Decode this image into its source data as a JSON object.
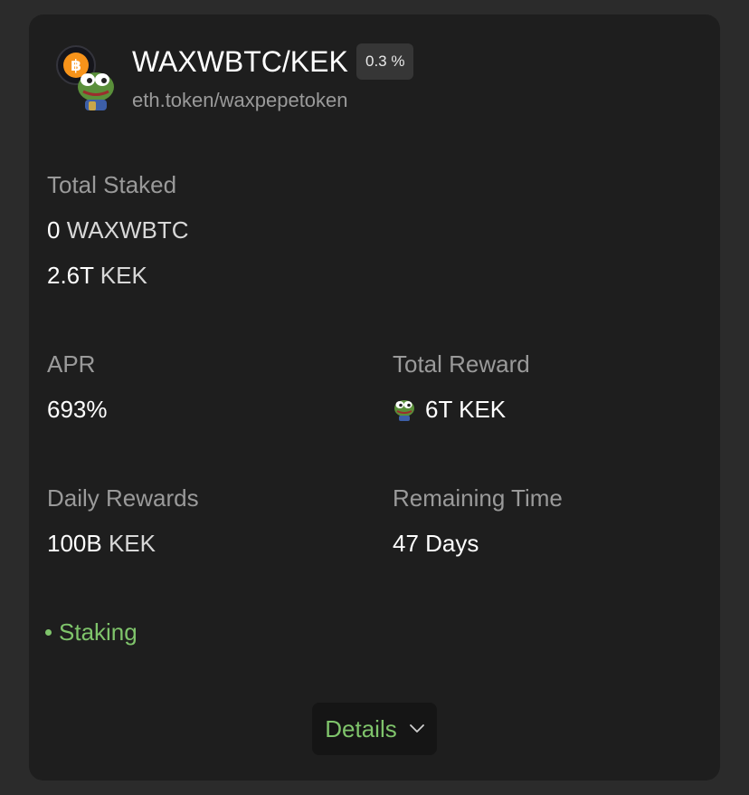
{
  "pool": {
    "pair_name": "WAXWBTC/KEK",
    "fee": "0.3 %",
    "contract": "eth.token/waxpepetoken",
    "icons": [
      "bitcoin-icon",
      "pepe-frog-icon"
    ]
  },
  "total_staked": {
    "label": "Total Staked",
    "token_a_amount": "0",
    "token_a_symbol": "WAXWBTC",
    "token_b_amount": "2.6T",
    "token_b_symbol": "KEK"
  },
  "apr": {
    "label": "APR",
    "value": "693%"
  },
  "total_reward": {
    "label": "Total Reward",
    "icon": "pepe-frog-icon",
    "amount": "6T",
    "symbol": "KEK"
  },
  "daily_rewards": {
    "label": "Daily Rewards",
    "amount": "100B",
    "symbol": "KEK"
  },
  "remaining_time": {
    "label": "Remaining Time",
    "value": "47 Days"
  },
  "status": {
    "label": "Staking",
    "color": "#7fc46b"
  },
  "details_button": {
    "label": "Details",
    "icon": "chevron-down-icon"
  },
  "colors": {
    "background": "#2b2b2b",
    "card": "#1e1e1e",
    "accent_green": "#7fc46b",
    "bitcoin_orange": "#f7931a"
  }
}
